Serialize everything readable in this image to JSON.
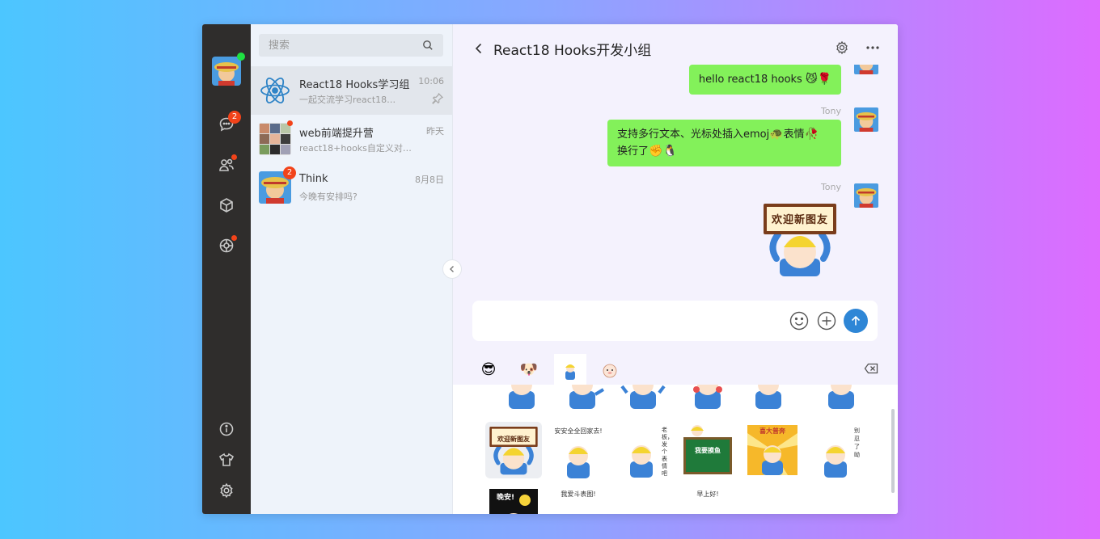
{
  "search": {
    "placeholder": "搜索"
  },
  "rail": {
    "chat_badge": "2"
  },
  "sessions": [
    {
      "name": "React18 Hooks学习组",
      "time": "10:06",
      "preview": "一起交流学习react18…"
    },
    {
      "name": "web前端提升营",
      "time": "昨天",
      "preview": "react18+hooks自定义对…"
    },
    {
      "name": "Think",
      "time": "8月8日",
      "preview": "今晚有安排吗?",
      "badge": "2"
    }
  ],
  "chat": {
    "title": "React18 Hooks开发小组",
    "messages": [
      {
        "text": "hello react18 hooks",
        "emojis": "😼🌹"
      },
      {
        "sender": "Tony",
        "line1": "支持多行文本、光标处插入emoj",
        "e1": "🐢",
        "line1b": "表情",
        "e2": "🥀",
        "line2": "换行了",
        "e3": "✊🐧"
      },
      {
        "sender": "Tony",
        "sticker_text": "欢迎新图友"
      }
    ]
  },
  "emoji_tabs": [
    "😎",
    "🐶"
  ],
  "stickers": {
    "row2": [
      {
        "text": "欢迎新图友"
      },
      {
        "text": "安安全全回家去!"
      },
      {
        "text": "老板，发个表情吧"
      },
      {
        "text": "我要摸鱼"
      },
      {
        "text": "喜大普奔"
      },
      {
        "text": "别忍了呦"
      }
    ],
    "row3": [
      {
        "text": "晚安!"
      },
      {
        "text": "我爱斗表图!"
      },
      {
        "text": "早上好!"
      }
    ]
  },
  "colors": {
    "bubble": "#83f15a",
    "send": "#2e86d6",
    "badge": "#f2431a",
    "rail": "#2f2d2c"
  }
}
